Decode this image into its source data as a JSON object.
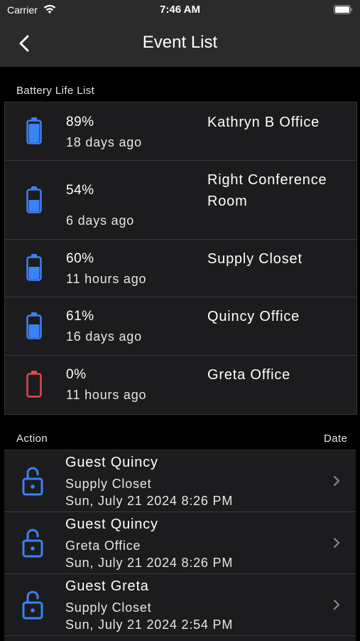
{
  "status_bar": {
    "carrier": "Carrier",
    "time": "7:46 AM"
  },
  "nav": {
    "title": "Event List",
    "back_icon": "chevron-left-icon"
  },
  "battery_section": {
    "header": "Battery Life List"
  },
  "batteries": [
    {
      "percent": "89%",
      "level": 0.89,
      "ago": "18 days ago",
      "location": "Kathryn B Office",
      "color": "#3b82f6"
    },
    {
      "percent": "54%",
      "level": 0.54,
      "ago": "6 days ago",
      "location": "Right Conference Room",
      "color": "#3b82f6"
    },
    {
      "percent": "60%",
      "level": 0.6,
      "ago": "11 hours ago",
      "location": "Supply Closet",
      "color": "#3b82f6"
    },
    {
      "percent": "61%",
      "level": 0.61,
      "ago": "16 days ago",
      "location": "Quincy Office",
      "color": "#3b82f6"
    },
    {
      "percent": "0%",
      "level": 0.0,
      "ago": "11 hours ago",
      "location": "Greta Office",
      "color": "#e5484d"
    }
  ],
  "events_section": {
    "action_header": "Action",
    "date_header": "Date"
  },
  "events": [
    {
      "name": "Guest Quincy",
      "location": "Supply Closet",
      "date": "Sun, July 21 2024 8:26 PM"
    },
    {
      "name": "Guest Quincy",
      "location": "Greta Office",
      "date": "Sun, July 21 2024 8:26 PM"
    },
    {
      "name": "Guest Greta",
      "location": "Supply Closet",
      "date": "Sun, July 21 2024 2:54 PM"
    }
  ],
  "colors": {
    "accent": "#3b82f6",
    "danger": "#e5484d",
    "cell": "#1c1c1e",
    "nav": "#2b2b2b"
  }
}
